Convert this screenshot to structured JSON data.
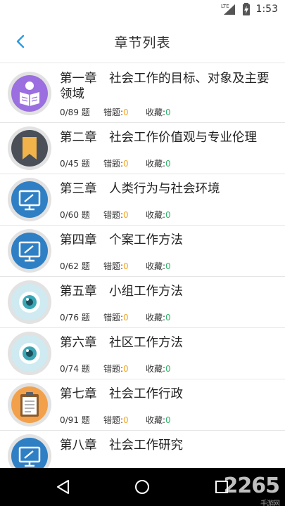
{
  "status_bar": {
    "network": "LTE",
    "time": "1:53"
  },
  "header": {
    "title": "章节列表"
  },
  "labels": {
    "wrong": "错题:",
    "fav": "收藏:",
    "unit": "题"
  },
  "chapters": [
    {
      "title": "第一章　社会工作的目标、对象及主要领域",
      "done": "0",
      "total": "89",
      "count": "0/89 题",
      "wrong": "0",
      "fav": "0",
      "icon": "reader-icon"
    },
    {
      "title": "第二章　社会工作价值观与专业伦理",
      "count": "0/45 题",
      "wrong": "0",
      "fav": "0",
      "icon": "bookmark-icon"
    },
    {
      "title": "第三章　人类行为与社会环境",
      "count": "0/60 题",
      "wrong": "0",
      "fav": "0",
      "icon": "monitor-icon"
    },
    {
      "title": "第四章　个案工作方法",
      "count": "0/62 题",
      "wrong": "0",
      "fav": "0",
      "icon": "monitor-icon"
    },
    {
      "title": "第五章　小组工作方法",
      "count": "0/76 题",
      "wrong": "0",
      "fav": "0",
      "icon": "eye-icon"
    },
    {
      "title": "第六章　社区工作方法",
      "count": "0/74 题",
      "wrong": "0",
      "fav": "0",
      "icon": "eye-icon"
    },
    {
      "title": "第七章　社会工作行政",
      "count": "0/91 题",
      "wrong": "0",
      "fav": "0",
      "icon": "clipboard-icon"
    },
    {
      "title": "第八章　社会工作研究",
      "count": "",
      "wrong": "",
      "fav": "",
      "icon": "monitor-icon"
    }
  ],
  "watermark": {
    "text": "2265",
    "sub": "手游网"
  }
}
